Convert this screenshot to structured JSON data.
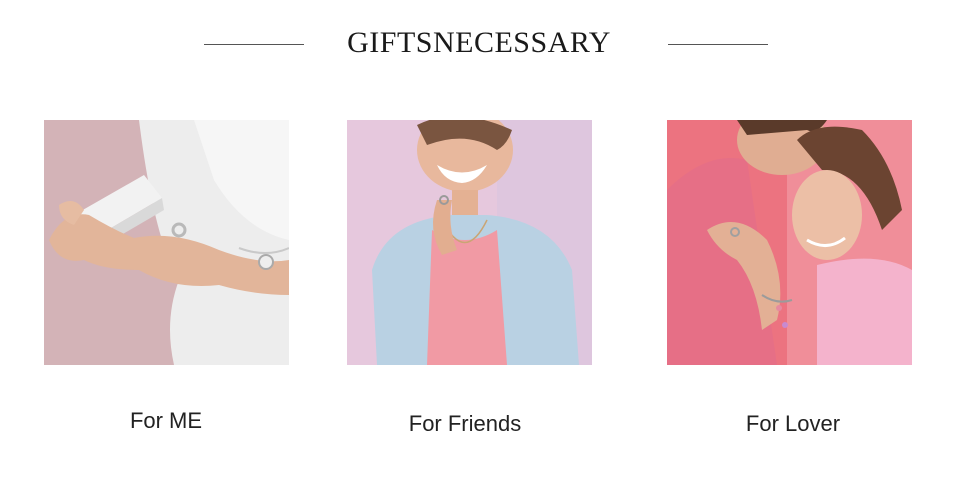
{
  "header": {
    "title": "GIFTSNECESSARY"
  },
  "cards": [
    {
      "label": "For ME",
      "photo": "hands-gift-box-photo"
    },
    {
      "label": "For Friends",
      "photo": "smiling-woman-denim-photo"
    },
    {
      "label": "For Lover",
      "photo": "couple-embrace-photo"
    }
  ],
  "colors": {
    "text": "#222222",
    "rule": "#555555",
    "background": "#ffffff"
  }
}
